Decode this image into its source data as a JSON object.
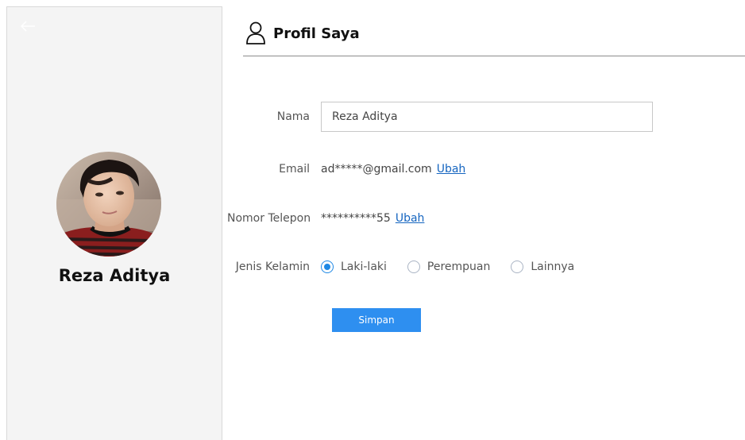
{
  "sidebar": {
    "back_icon": "arrow-left-icon",
    "user_name": "Reza Aditya"
  },
  "header": {
    "icon": "user-outline-icon",
    "title": "Profil Saya"
  },
  "form": {
    "name_label": "Nama",
    "name_value": "Reza Aditya",
    "email_label": "Email",
    "email_value": "ad*****@gmail.com",
    "email_change": "Ubah",
    "phone_label": "Nomor Telepon",
    "phone_value": "**********55",
    "phone_change": "Ubah",
    "gender_label": "Jenis Kelamin",
    "gender_options": [
      {
        "label": "Laki-laki",
        "checked": true
      },
      {
        "label": "Perempuan",
        "checked": false
      },
      {
        "label": "Lainnya",
        "checked": false
      }
    ],
    "save_label": "Simpan"
  },
  "colors": {
    "accent": "#2e8ff0",
    "link": "#1565c0",
    "sidebar_bg": "#f4f4f4"
  }
}
